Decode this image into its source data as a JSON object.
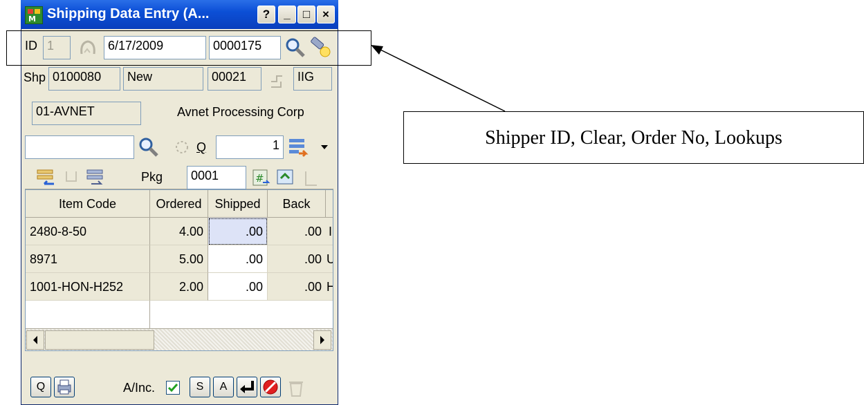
{
  "window": {
    "title": "Shipping Data Entry (A...",
    "help_btn": "?",
    "min_btn": "_",
    "max_btn": "□",
    "close_btn": "×"
  },
  "row1": {
    "id_label": "ID",
    "id_value": "1",
    "date": "6/17/2009",
    "order_no": "0000175"
  },
  "row2": {
    "shp_label": "Shp",
    "shipper_no": "0100080",
    "status": "New",
    "code": "00021",
    "warehouse": "IIG"
  },
  "customer": {
    "number": "01-AVNET",
    "name": "Avnet Processing Corp"
  },
  "row4": {
    "search_value": "",
    "q_label": "Q",
    "qty": "1"
  },
  "row5": {
    "pkg_label": "Pkg",
    "pkg_value": "0001"
  },
  "grid": {
    "columns": [
      "Item Code",
      "Ordered",
      "Shipped",
      "Back"
    ],
    "rows": [
      {
        "item": "2480-8-50",
        "ordered": "4.00",
        "shipped": ".00",
        "back": ".00",
        "extra": "I"
      },
      {
        "item": "8971",
        "ordered": "5.00",
        "shipped": ".00",
        "back": ".00",
        "extra": "U"
      },
      {
        "item": "1001-HON-H252",
        "ordered": "2.00",
        "shipped": ".00",
        "back": ".00",
        "extra": "H"
      }
    ]
  },
  "footer": {
    "q_btn": "Q",
    "ainc_label": "A/Inc.",
    "s_btn": "S",
    "a_btn": "A"
  },
  "annotation": {
    "text": "Shipper ID, Clear, Order No, Lookups"
  }
}
